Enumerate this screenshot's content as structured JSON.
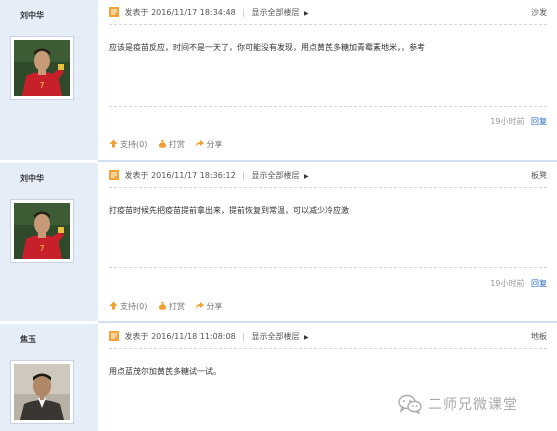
{
  "posts": [
    {
      "author": "刘中华",
      "posted_at": "发表于 2016/11/17 18:34:48",
      "show_all": "显示全部楼层",
      "floor": "沙发",
      "content": "应该是疫苗反应，时间不是一天了，你可能没有发现，用点黄芪多糖加青霉素地米，，参考",
      "time_ago": "19小时前",
      "reply": "回复",
      "support": "支持(0)",
      "tip": "打赏",
      "share": "分享"
    },
    {
      "author": "刘中华",
      "posted_at": "发表于 2016/11/17 18:36:12",
      "show_all": "显示全部楼层",
      "floor": "板凳",
      "content": "打疫苗时候先把疫苗提前拿出来，提前恢复到常温，可以减少冷应激",
      "time_ago": "19小时前",
      "reply": "回复",
      "support": "支持(0)",
      "tip": "打赏",
      "share": "分享"
    },
    {
      "author": "焦玉",
      "posted_at": "发表于 2016/11/18 11:08:08",
      "show_all": "显示全部楼层",
      "floor": "地板",
      "content": "用点蓝茂尔加黄芪多糖试一试。"
    }
  ],
  "watermark": {
    "text": "二师兄微课堂",
    "icon": "wechat-icon"
  },
  "colors": {
    "sidebar": "#e5edf8",
    "link": "#2266bb",
    "separator": "#d0dff1"
  }
}
